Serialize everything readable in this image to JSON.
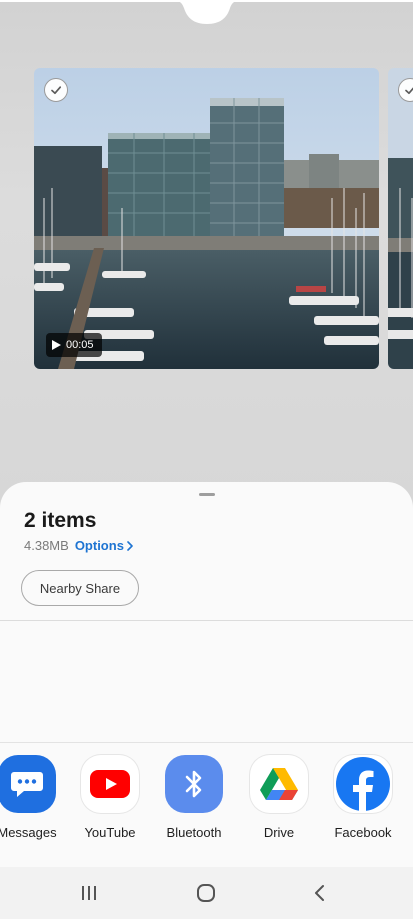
{
  "gallery": {
    "video_duration": "00:05"
  },
  "sheet": {
    "title": "2 items",
    "size": "4.38MB",
    "options_label": "Options",
    "nearby_share_label": "Nearby Share"
  },
  "apps": [
    {
      "label": "Messages",
      "icon": "messages-icon",
      "color": "#1e6fd9"
    },
    {
      "label": "YouTube",
      "icon": "youtube-icon",
      "color": "#ff0000"
    },
    {
      "label": "Bluetooth",
      "icon": "bluetooth-icon",
      "color": "#4e85e8"
    },
    {
      "label": "Drive",
      "icon": "drive-icon",
      "color": "#ffffff"
    },
    {
      "label": "Facebook",
      "icon": "facebook-icon",
      "color": "#1877f2"
    }
  ],
  "nav": {
    "recents": "recents-icon",
    "home": "home-icon",
    "back": "back-icon"
  }
}
